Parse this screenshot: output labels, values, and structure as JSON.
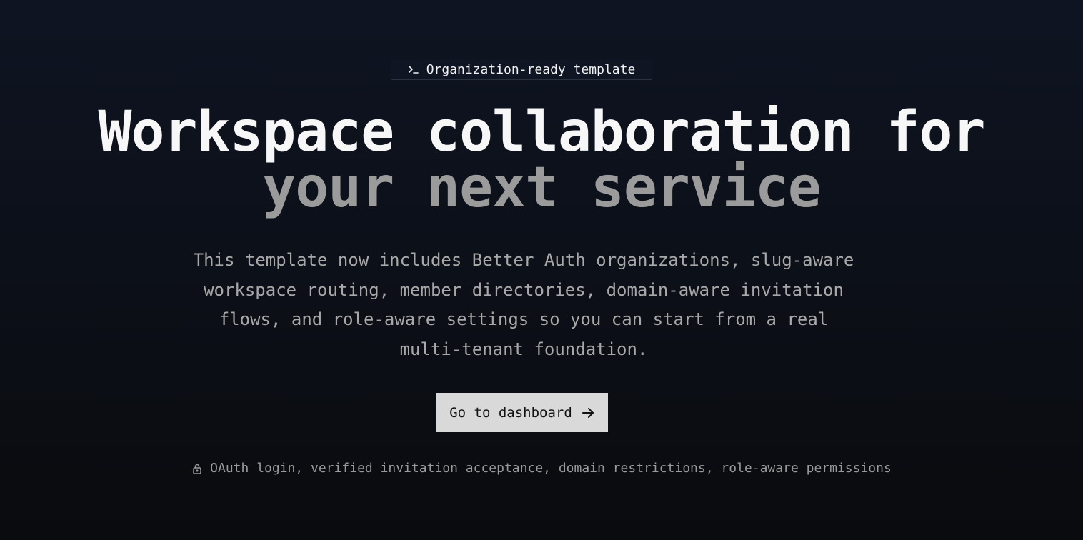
{
  "badge": {
    "icon": "terminal-icon",
    "text": "Organization-ready template"
  },
  "headline": {
    "line1": "Workspace collaboration for",
    "line2": "your next service"
  },
  "description": "This template now includes Better Auth organizations, slug-aware workspace routing, member directories, domain-aware invitation flows, and role-aware settings so you can start from a real multi-tenant foundation.",
  "cta": {
    "label": "Go to dashboard",
    "icon": "arrow-right-icon"
  },
  "features": {
    "icon": "lock-icon",
    "text": "OAuth login, verified invitation acceptance, domain restrictions, role-aware permissions"
  },
  "colors": {
    "background": "#0c1019",
    "headline_primary": "#f7f7f7",
    "headline_secondary": "#9b9b9b",
    "cta_background": "#d9d9d9"
  }
}
